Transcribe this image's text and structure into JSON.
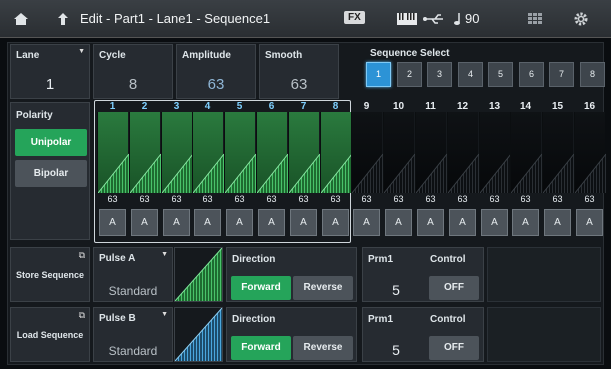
{
  "topbar": {
    "title": "Edit - Part1 - Lane1 - Sequence1",
    "fx_label": "FX",
    "tempo": "90",
    "icons": [
      "home-icon",
      "up-arrow-icon",
      "keyboard-icon",
      "usb-icon",
      "note-icon",
      "grid-icon",
      "gear-icon"
    ]
  },
  "lane": {
    "label": "Lane",
    "value": "1"
  },
  "cycle": {
    "label": "Cycle",
    "value": "8"
  },
  "amplitude": {
    "label": "Amplitude",
    "value": "63"
  },
  "smooth": {
    "label": "Smooth",
    "value": "63"
  },
  "sequence_select": {
    "label": "Sequence Select",
    "options": [
      "1",
      "2",
      "3",
      "4",
      "5",
      "6",
      "7",
      "8"
    ],
    "selected": "1"
  },
  "polarity": {
    "label": "Polarity",
    "options": [
      "Unipolar",
      "Bipolar"
    ],
    "selected": "Unipolar"
  },
  "steps": {
    "numbers": [
      "1",
      "2",
      "3",
      "4",
      "5",
      "6",
      "7",
      "8",
      "9",
      "10",
      "11",
      "12",
      "13",
      "14",
      "15",
      "16"
    ],
    "values": [
      "63",
      "63",
      "63",
      "63",
      "63",
      "63",
      "63",
      "63",
      "63",
      "63",
      "63",
      "63",
      "63",
      "63",
      "63",
      "63"
    ],
    "types": [
      "A",
      "A",
      "A",
      "A",
      "A",
      "A",
      "A",
      "A",
      "A",
      "A",
      "A",
      "A",
      "A",
      "A",
      "A",
      "A"
    ],
    "active_count": 8
  },
  "store_sequence": {
    "label": "Store Sequence"
  },
  "load_sequence": {
    "label": "Load Sequence"
  },
  "pulse_a": {
    "label": "Pulse A",
    "value": "Standard",
    "direction_label": "Direction",
    "direction_options": [
      "Forward",
      "Reverse"
    ],
    "direction_selected": "Forward",
    "prm1_label": "Prm1",
    "prm1_value": "5",
    "control_label": "Control",
    "control_value": "OFF"
  },
  "pulse_b": {
    "label": "Pulse B",
    "value": "Standard",
    "direction_label": "Direction",
    "direction_options": [
      "Forward",
      "Reverse"
    ],
    "direction_selected": "Forward",
    "prm1_label": "Prm1",
    "prm1_value": "5",
    "control_label": "Control",
    "control_value": "OFF"
  },
  "colors": {
    "accent_blue": "#2c93d6",
    "accent_green": "#25a45a",
    "step_green": "#2a7a3e"
  }
}
